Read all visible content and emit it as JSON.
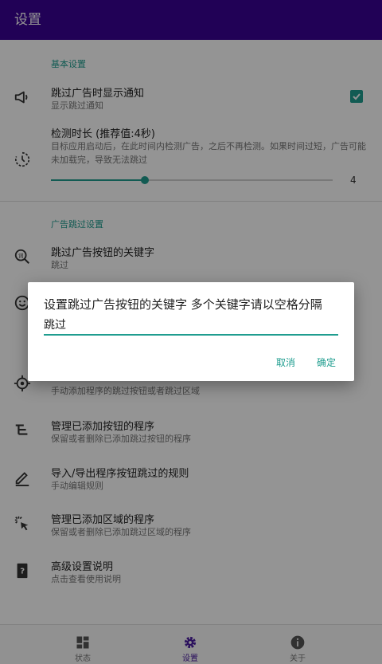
{
  "appbar": {
    "title": "设置"
  },
  "sections": {
    "basic": "基本设置",
    "ad_skip": "广告跳过设置"
  },
  "items": [
    {
      "title": "跳过广告时显示通知",
      "sub": "显示跳过通知",
      "icon": "megaphone-icon"
    },
    {
      "title": "检测时长 (推荐值:4秒)",
      "sub": "目标应用启动后，在此时间内检测广告，之后不再检测。如果时间过短，广告可能未加载完，导致无法跳过",
      "icon": "timer-icon"
    },
    {
      "title": "跳过广告按钮的关键字",
      "sub": "跳过",
      "icon": "keyword-search-icon"
    },
    {
      "title": "",
      "sub": "",
      "icon": "smiley-icon"
    },
    {
      "title": "",
      "sub": "手动添加程序的跳过按钮或者跳过区域",
      "icon": "target-icon"
    },
    {
      "title": "管理已添加按钮的程序",
      "sub": "保留或者删除已添加跳过按钮的程序",
      "icon": "tree-list-icon"
    },
    {
      "title": "导入/导出程序按钮跳过的规则",
      "sub": "手动编辑规则",
      "icon": "pencil-icon"
    },
    {
      "title": "管理已添加区域的程序",
      "sub": "保留或者删除已添加跳过区域的程序",
      "icon": "click-pointer-icon"
    },
    {
      "title": "高级设置说明",
      "sub": "点击查看使用说明",
      "icon": "help-book-icon"
    }
  ],
  "slider": {
    "value": 4,
    "min": 0,
    "max": 12,
    "value_label": "4"
  },
  "checkbox": {
    "checked": true
  },
  "bottom_nav": [
    {
      "label": "状态",
      "icon": "dashboard-icon"
    },
    {
      "label": "设置",
      "icon": "gear-icon"
    },
    {
      "label": "关于",
      "icon": "info-icon"
    }
  ],
  "colors": {
    "primary": "#3a0294",
    "accent": "#1f9d8f"
  },
  "dialog": {
    "title": "设置跳过广告按钮的关键字 多个关键字请以空格分隔",
    "input_value": "跳过",
    "cancel_label": "取消",
    "ok_label": "确定"
  }
}
